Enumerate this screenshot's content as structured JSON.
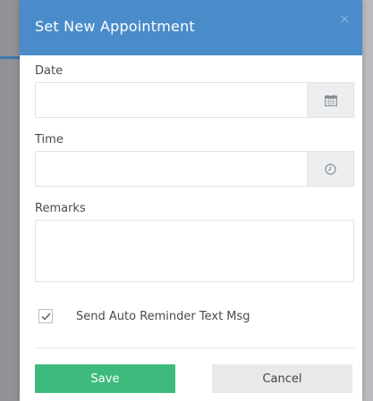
{
  "modal": {
    "title": "Set New Appointment",
    "close_glyph": "×",
    "header_color": "#4a8cca"
  },
  "form": {
    "date": {
      "label": "Date",
      "value": "",
      "placeholder": "",
      "icon": "calendar-icon"
    },
    "time": {
      "label": "Time",
      "value": "",
      "placeholder": "",
      "icon": "clock-icon"
    },
    "remarks": {
      "label": "Remarks",
      "value": "",
      "placeholder": ""
    },
    "reminder": {
      "label": "Send Auto Reminder Text Msg",
      "checked": true
    }
  },
  "buttons": {
    "save_label": "Save",
    "cancel_label": "Cancel",
    "save_color": "#3dbb7d",
    "cancel_color": "#e8e9ea"
  }
}
